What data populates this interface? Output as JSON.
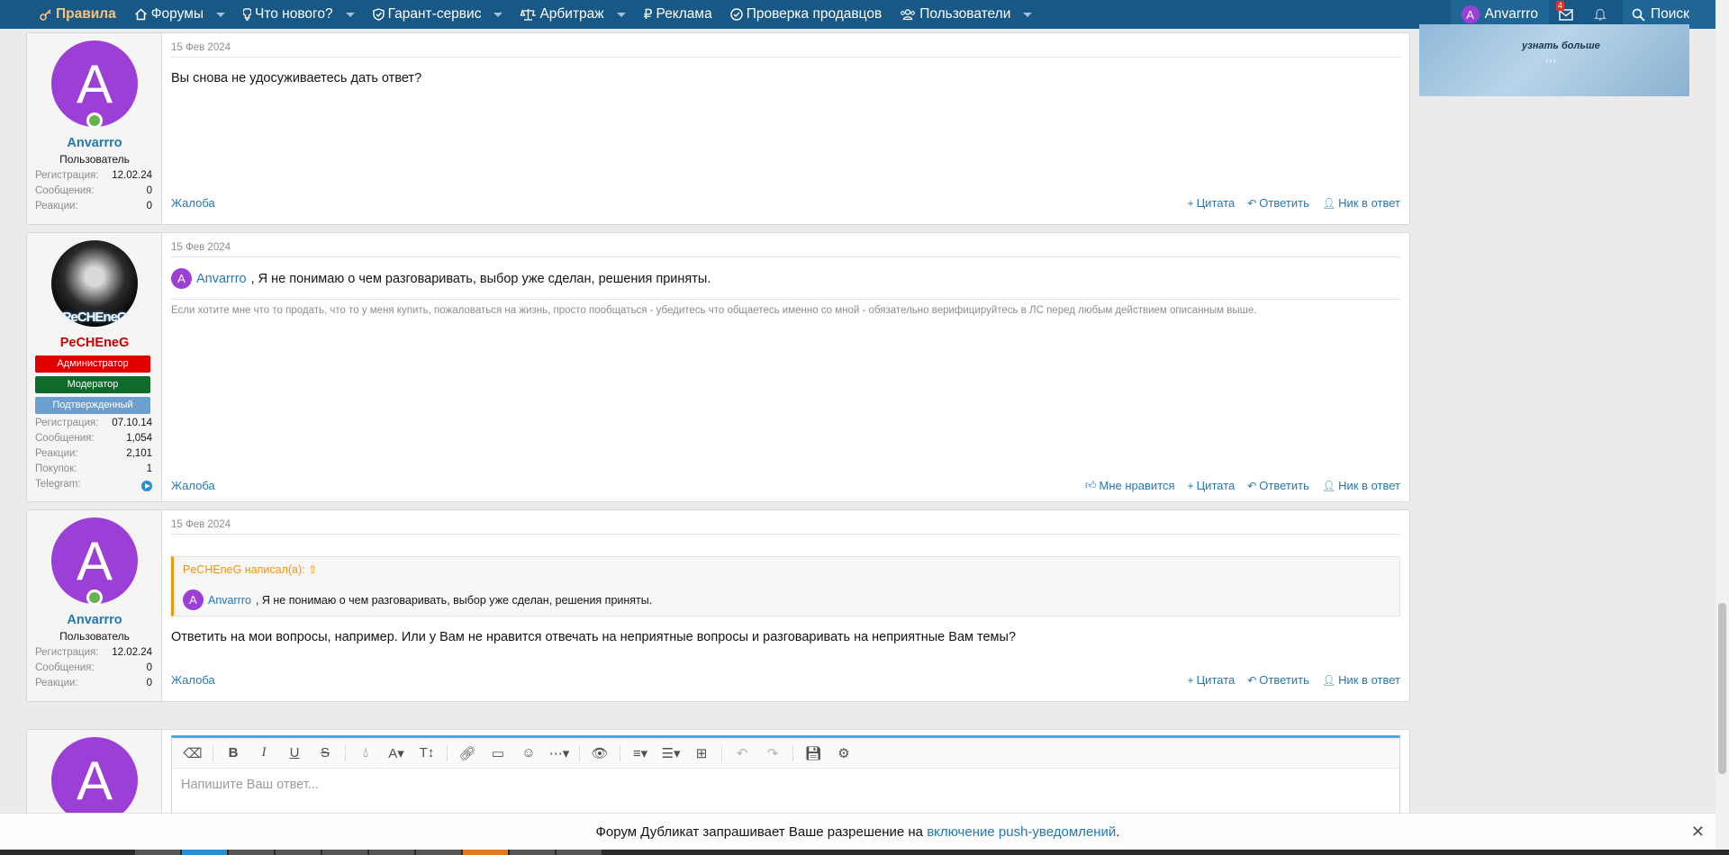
{
  "nav": {
    "items": [
      {
        "label": "Правила",
        "icon": "key-icon",
        "caret": false,
        "active": true
      },
      {
        "label": "Форумы",
        "icon": "home-icon",
        "caret": true
      },
      {
        "label": "Что нового?",
        "icon": "bulb-icon",
        "caret": true
      },
      {
        "label": "Гарант-сервис",
        "icon": "shield-icon",
        "caret": true
      },
      {
        "label": "Арбитраж",
        "icon": "scales-icon",
        "caret": true
      },
      {
        "label": "Реклама",
        "icon": "ruble-icon",
        "caret": false
      },
      {
        "label": "Проверка продавцов",
        "icon": "check-circle-icon",
        "caret": false
      },
      {
        "label": "Пользователи",
        "icon": "users-icon",
        "caret": true
      }
    ],
    "user": {
      "initial": "A",
      "name": "Anvarrro"
    },
    "inbox_badge": "4",
    "search_label": "Поиск"
  },
  "ad": {
    "text": "узнать больше",
    "arrows": "›››"
  },
  "posts": [
    {
      "date": "15 Фев 2024",
      "author": {
        "initial": "A",
        "name": "Anvarrro",
        "title": "Пользователь",
        "stats": [
          {
            "k": "Регистрация:",
            "v": "12.02.24"
          },
          {
            "k": "Сообщения:",
            "v": "0"
          },
          {
            "k": "Реакции:",
            "v": "0"
          }
        ]
      },
      "text": "Вы снова не удосуживаетесь дать ответ?",
      "report": "Жалоба",
      "actions": [
        "Цитата",
        "Ответить",
        "Ник в ответ"
      ]
    },
    {
      "date": "15 Фев 2024",
      "author": {
        "name": "PeCHEneG",
        "avatar_text": "PeCHEneG",
        "badges": [
          {
            "label": "Администратор",
            "color": "#e00000"
          },
          {
            "label": "Модератор",
            "color": "#0f6b2b"
          },
          {
            "label": "Подтвержденный",
            "color": "#6c9ecf"
          }
        ],
        "stats": [
          {
            "k": "Регистрация:",
            "v": "07.10.14"
          },
          {
            "k": "Сообщения:",
            "v": "1,054"
          },
          {
            "k": "Реакции:",
            "v": "2,101"
          },
          {
            "k": "Покупок:",
            "v": "1"
          },
          {
            "k": "Telegram:",
            "v": ""
          }
        ]
      },
      "mention_initial": "A",
      "mention": "Anvarrro",
      "text": ", Я не понимаю о чем разговаривать, выбор уже сделан, решения приняты.",
      "signature": "Если хотите мне что то продать, что то у меня купить, пожаловаться на жизнь, просто пообщаться - убедитесь что общаетесь именно со мной - обязательно верифицируйтесь в ЛС перед любым действием описанным выше.",
      "report": "Жалоба",
      "actions": [
        "Мне нравится",
        "Цитата",
        "Ответить",
        "Ник в ответ"
      ]
    },
    {
      "date": "15 Фев 2024",
      "author": {
        "initial": "A",
        "name": "Anvarrro",
        "title": "Пользователь",
        "stats": [
          {
            "k": "Регистрация:",
            "v": "12.02.24"
          },
          {
            "k": "Сообщения:",
            "v": "0"
          },
          {
            "k": "Реакции:",
            "v": "0"
          }
        ]
      },
      "quote": {
        "head": "PeCHEneG написал(а):",
        "mention_initial": "A",
        "mention": "Anvarrro",
        "text": ", Я не понимаю о чем разговаривать, выбор уже сделан, решения приняты."
      },
      "text": "Ответить на мои вопросы, например. Или у Вам не нравится отвечать на неприятные вопросы и разговаривать на неприятные Вам темы?",
      "report": "Жалоба",
      "actions": [
        "Цитата",
        "Ответить",
        "Ник в ответ"
      ]
    }
  ],
  "editor": {
    "avatar_initial": "A",
    "placeholder": "Напишите Ваш ответ..."
  },
  "notice": {
    "prefix": "Форум Дубликат запрашивает Ваше разрешение на ",
    "link": "включение push-уведомлений",
    "suffix": ".",
    "close": "✕"
  }
}
